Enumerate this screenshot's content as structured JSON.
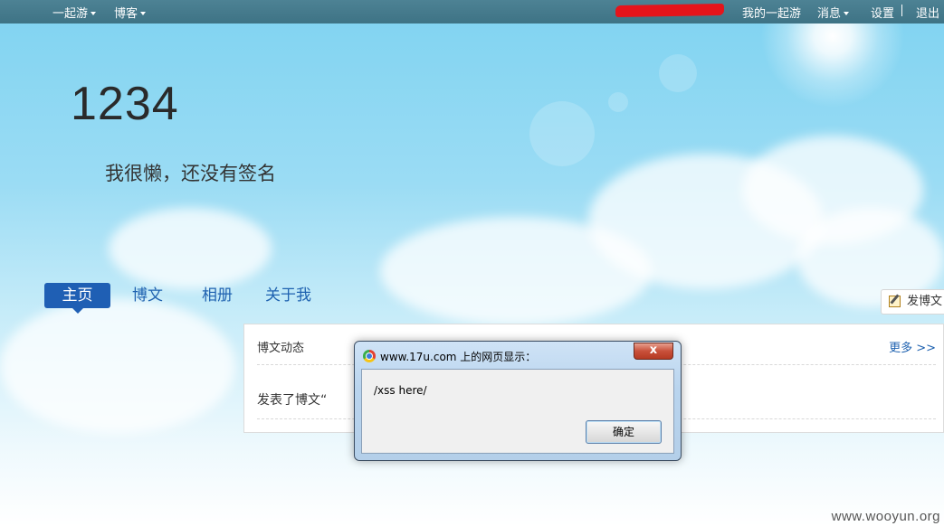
{
  "topbar": {
    "nav_left": [
      {
        "label": "一起游"
      },
      {
        "label": "博客"
      }
    ],
    "my_link": "我的一起游",
    "messages": "消息",
    "settings": "设置",
    "logout": "退出"
  },
  "profile": {
    "name": "1234",
    "signature": "我很懒，还没有签名"
  },
  "nav": {
    "tabs": [
      {
        "label": "主页",
        "active": true
      },
      {
        "label": "博文"
      },
      {
        "label": "相册"
      },
      {
        "label": "关于我"
      }
    ]
  },
  "post_button": {
    "label": "发博文",
    "icon": "edit-icon"
  },
  "feed": {
    "title": "博文动态",
    "more": "更多 >>",
    "activity": "发表了博文“"
  },
  "dialog": {
    "title": "www.17u.com 上的网页显示：",
    "close": "x",
    "message": "/xss here/",
    "ok": "确定",
    "icon": "chrome-icon"
  },
  "watermark": "www.wooyun.org"
}
